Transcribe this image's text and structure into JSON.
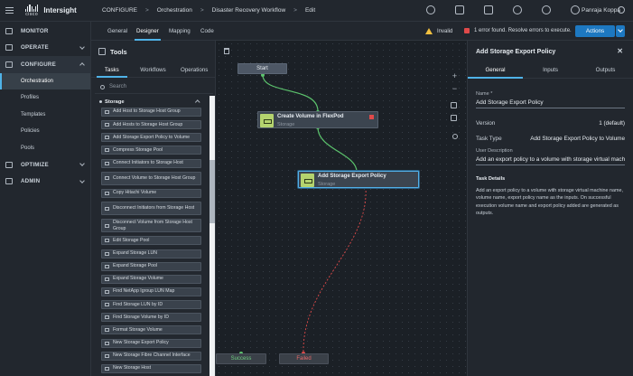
{
  "topbar": {
    "cisco": "cisco",
    "brand": "Intersight",
    "breadcrumbs": [
      "CONFIGURE",
      "Orchestration",
      "Disaster Recovery Workflow",
      "Edit"
    ],
    "user": "Panraja Koppa"
  },
  "nav": {
    "items": [
      {
        "label": "MONITOR",
        "icon": "monitor-icon"
      },
      {
        "label": "OPERATE",
        "icon": "operate-icon"
      },
      {
        "label": "CONFIGURE",
        "icon": "configure-icon"
      },
      {
        "label": "OPTIMIZE",
        "icon": "optimize-icon"
      },
      {
        "label": "ADMIN",
        "icon": "admin-icon"
      }
    ],
    "sub": [
      "Orchestration",
      "Profiles",
      "Templates",
      "Policies",
      "Pools"
    ]
  },
  "workflow_tabs": [
    "General",
    "Designer",
    "Mapping",
    "Code"
  ],
  "status": {
    "invalid": "Invalid",
    "error": "1 error found. Resolve errors to execute."
  },
  "actions_label": "Actions",
  "tools": {
    "title": "Tools",
    "tabs": [
      "Tasks",
      "Workflows",
      "Operations"
    ],
    "search_placeholder": "Search",
    "category": "Storage",
    "items": [
      "Add Host to Storage Host Group",
      "Add Hosts to Storage Host Group",
      "Add Storage Export Policy to Volume",
      "Compress Storage Pool",
      "Connect Initiators to Storage Host",
      "Connect Volume to Storage Host Group",
      "Copy Hitachi Volume",
      "Disconnect Initiators from Storage Host",
      "Disconnect Volume from Storage Host Group",
      "Edit Storage Pool",
      "Expand Storage LUN",
      "Expand Storage Pool",
      "Expand Storage Volume",
      "Find NetApp Igroup LUN Map",
      "Find Storage LUN by ID",
      "Find Storage Volume by ID",
      "Format Storage Volume",
      "New Storage Export Policy",
      "New Storage Fibre Channel Interface",
      "New Storage Host"
    ]
  },
  "canvas": {
    "start": "Start",
    "task1": {
      "name": "Create Volume in FlexPod",
      "category": "Storage"
    },
    "task2": {
      "name": "Add Storage Export Policy",
      "category": "Storage"
    },
    "success": "Success",
    "failed": "Failed"
  },
  "panel": {
    "title": "Add Storage Export Policy",
    "tabs": [
      "General",
      "Inputs",
      "Outputs"
    ],
    "name_label": "Name *",
    "name_value": "Add Storage Export Policy",
    "version_label": "Version",
    "version_value": "1 (default)",
    "tasktype_label": "Task Type",
    "tasktype_value": "Add Storage Export Policy to Volume",
    "udesc_label": "User Description",
    "udesc_value": "Add an export policy to a volume with storage virtual machi",
    "details_title": "Task Details",
    "details_text": "Add an export policy to a volume with storage virtual machine name, volume name, export policy name as the inputs. On successful execution volume name and export policy added are generated as outputs."
  },
  "colors": {
    "accent": "#4fb3e8",
    "button": "#1d78c1",
    "error": "#e04a4a",
    "success": "#6fcf82",
    "task_tile": "#b4d36e",
    "warning": "#f2c040"
  }
}
